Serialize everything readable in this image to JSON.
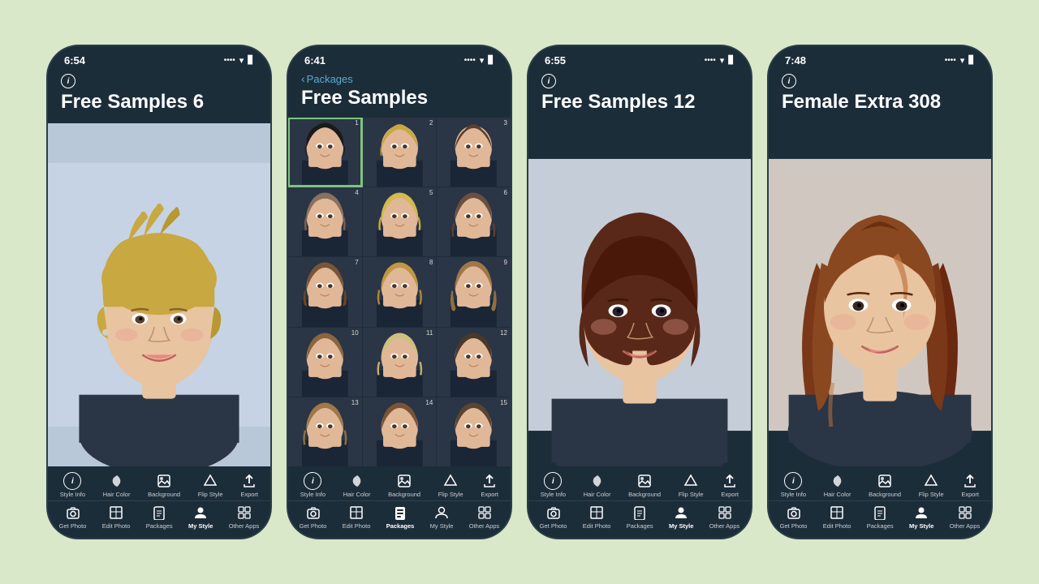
{
  "background_color": "#d8e8c8",
  "phones": [
    {
      "id": "phone1",
      "time": "6:54",
      "has_back": false,
      "title": "Free Samples 6",
      "view": "portrait",
      "active_tab_top": "",
      "active_tab_bottom": "my_style",
      "toolbar_top": [
        {
          "id": "style_info",
          "label": "Style Info",
          "icon": "ℹ"
        },
        {
          "id": "hair_color",
          "label": "Hair Color",
          "icon": "🪣"
        },
        {
          "id": "background",
          "label": "Background",
          "icon": "🖼"
        },
        {
          "id": "flip_style",
          "label": "Flip Style",
          "icon": "△"
        },
        {
          "id": "export",
          "label": "Export",
          "icon": "↗"
        }
      ],
      "toolbar_bottom": [
        {
          "id": "get_photo",
          "label": "Get Photo",
          "icon": "📷"
        },
        {
          "id": "edit_photo",
          "label": "Edit Photo",
          "icon": "⊞"
        },
        {
          "id": "packages",
          "label": "Packages",
          "icon": "📱"
        },
        {
          "id": "my_style",
          "label": "My Style",
          "icon": "👤",
          "active": true
        },
        {
          "id": "other_apps",
          "label": "Other Apps",
          "icon": "⊡"
        }
      ]
    },
    {
      "id": "phone2",
      "time": "6:41",
      "has_back": true,
      "back_label": "Packages",
      "title": "Free Samples",
      "view": "grid",
      "active_tab_bottom": "packages",
      "grid_cells": [
        {
          "num": 1,
          "selected": true
        },
        {
          "num": 2
        },
        {
          "num": 3
        },
        {
          "num": 4
        },
        {
          "num": 5
        },
        {
          "num": 6
        },
        {
          "num": 7
        },
        {
          "num": 8
        },
        {
          "num": 9
        },
        {
          "num": 10
        },
        {
          "num": 11
        },
        {
          "num": 12
        },
        {
          "num": 13
        },
        {
          "num": 14
        },
        {
          "num": 15
        }
      ],
      "toolbar_top": [
        {
          "id": "style_info",
          "label": "Style Info",
          "icon": "ℹ"
        },
        {
          "id": "hair_color",
          "label": "Hair Color",
          "icon": "🪣"
        },
        {
          "id": "background",
          "label": "Background",
          "icon": "🖼"
        },
        {
          "id": "flip_style",
          "label": "Flip Style",
          "icon": "△"
        },
        {
          "id": "export",
          "label": "Export",
          "icon": "↗"
        }
      ],
      "toolbar_bottom": [
        {
          "id": "get_photo",
          "label": "Get Photo",
          "icon": "📷"
        },
        {
          "id": "edit_photo",
          "label": "Edit Photo",
          "icon": "⊞"
        },
        {
          "id": "packages",
          "label": "Packages",
          "icon": "📱",
          "active": true
        },
        {
          "id": "my_style",
          "label": "My Style",
          "icon": "👤"
        },
        {
          "id": "other_apps",
          "label": "Other Apps",
          "icon": "⊡"
        }
      ]
    },
    {
      "id": "phone3",
      "time": "6:55",
      "has_back": false,
      "title": "Free Samples 12",
      "view": "portrait",
      "active_tab_bottom": "my_style",
      "toolbar_top": [
        {
          "id": "style_info",
          "label": "Style Info",
          "icon": "ℹ"
        },
        {
          "id": "hair_color",
          "label": "Hair Color",
          "icon": "🪣"
        },
        {
          "id": "background",
          "label": "Background",
          "icon": "🖼"
        },
        {
          "id": "flip_style",
          "label": "Flip Style",
          "icon": "△"
        },
        {
          "id": "export",
          "label": "Export",
          "icon": "↗"
        }
      ],
      "toolbar_bottom": [
        {
          "id": "get_photo",
          "label": "Get Photo",
          "icon": "📷"
        },
        {
          "id": "edit_photo",
          "label": "Edit Photo",
          "icon": "⊞"
        },
        {
          "id": "packages",
          "label": "Packages",
          "icon": "📱"
        },
        {
          "id": "my_style",
          "label": "My Style",
          "icon": "👤",
          "active": true
        },
        {
          "id": "other_apps",
          "label": "Other Apps",
          "icon": "⊡"
        }
      ]
    },
    {
      "id": "phone4",
      "time": "7:48",
      "has_back": false,
      "title": "Female Extra 308",
      "view": "portrait",
      "active_tab_bottom": "my_style",
      "toolbar_top": [
        {
          "id": "style_info",
          "label": "Style Info",
          "icon": "ℹ"
        },
        {
          "id": "hair_color",
          "label": "Hair Color",
          "icon": "🪣"
        },
        {
          "id": "background",
          "label": "Background",
          "icon": "🖼"
        },
        {
          "id": "flip_style",
          "label": "Flip Style",
          "icon": "△"
        },
        {
          "id": "export",
          "label": "Export",
          "icon": "↗"
        }
      ],
      "toolbar_bottom": [
        {
          "id": "get_photo",
          "label": "Get Photo",
          "icon": "📷"
        },
        {
          "id": "edit_photo",
          "label": "Edit Photo",
          "icon": "⊞"
        },
        {
          "id": "packages",
          "label": "Packages",
          "icon": "📱"
        },
        {
          "id": "my_style",
          "label": "My Style",
          "icon": "👤",
          "active": true
        },
        {
          "id": "other_apps",
          "label": "Other Apps",
          "icon": "⊡"
        }
      ]
    }
  ],
  "labels": {
    "style_info": "Style Info",
    "hair_color": "Hair Color",
    "background": "Background",
    "flip_style": "Flip Style",
    "export": "Export",
    "get_photo": "Get Photo",
    "edit_photo": "Edit Photo",
    "packages": "Packages",
    "my_style": "My Style",
    "other_apps": "Other Apps"
  }
}
